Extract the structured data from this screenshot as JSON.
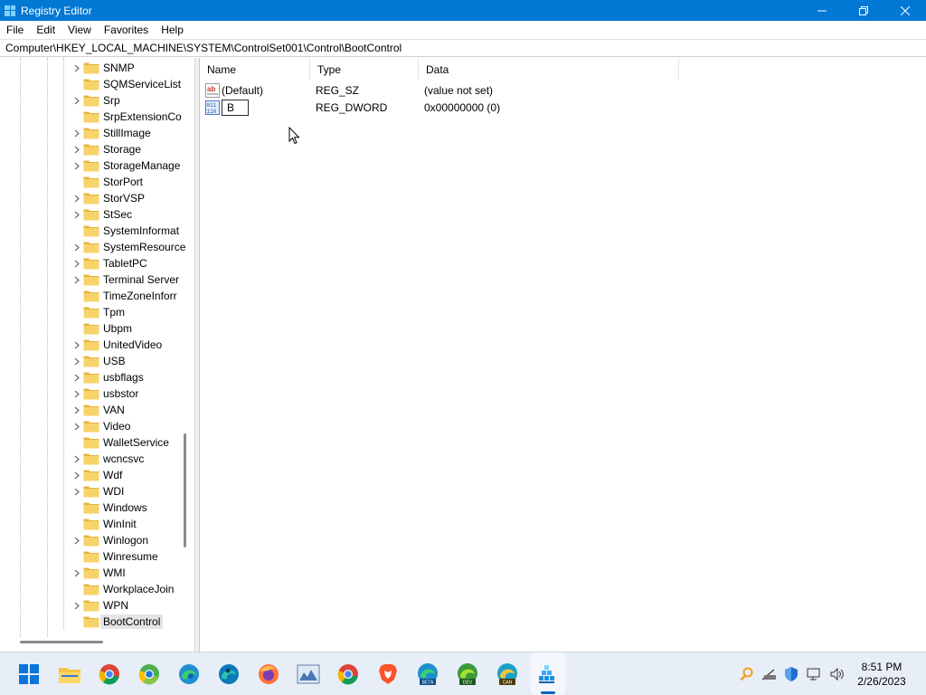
{
  "window": {
    "title": "Registry Editor"
  },
  "menu": [
    "File",
    "Edit",
    "View",
    "Favorites",
    "Help"
  ],
  "address": "Computer\\HKEY_LOCAL_MACHINE\\SYSTEM\\ControlSet001\\Control\\BootControl",
  "tree": {
    "items": [
      {
        "label": "SNMP",
        "expandable": true
      },
      {
        "label": "SQMServiceList",
        "expandable": false
      },
      {
        "label": "Srp",
        "expandable": true
      },
      {
        "label": "SrpExtensionCo",
        "expandable": false
      },
      {
        "label": "StillImage",
        "expandable": true
      },
      {
        "label": "Storage",
        "expandable": true
      },
      {
        "label": "StorageManage",
        "expandable": true
      },
      {
        "label": "StorPort",
        "expandable": false
      },
      {
        "label": "StorVSP",
        "expandable": true
      },
      {
        "label": "StSec",
        "expandable": true
      },
      {
        "label": "SystemInformat",
        "expandable": false
      },
      {
        "label": "SystemResource",
        "expandable": true
      },
      {
        "label": "TabletPC",
        "expandable": true
      },
      {
        "label": "Terminal Server",
        "expandable": true
      },
      {
        "label": "TimeZoneInforr",
        "expandable": false
      },
      {
        "label": "Tpm",
        "expandable": false
      },
      {
        "label": "Ubpm",
        "expandable": false
      },
      {
        "label": "UnitedVideo",
        "expandable": true
      },
      {
        "label": "USB",
        "expandable": true
      },
      {
        "label": "usbflags",
        "expandable": true
      },
      {
        "label": "usbstor",
        "expandable": true
      },
      {
        "label": "VAN",
        "expandable": true
      },
      {
        "label": "Video",
        "expandable": true
      },
      {
        "label": "WalletService",
        "expandable": false
      },
      {
        "label": "wcncsvc",
        "expandable": true
      },
      {
        "label": "Wdf",
        "expandable": true
      },
      {
        "label": "WDI",
        "expandable": true
      },
      {
        "label": "Windows",
        "expandable": false
      },
      {
        "label": "WinInit",
        "expandable": false
      },
      {
        "label": "Winlogon",
        "expandable": true
      },
      {
        "label": "Winresume",
        "expandable": false
      },
      {
        "label": "WMI",
        "expandable": true
      },
      {
        "label": "WorkplaceJoin",
        "expandable": false
      },
      {
        "label": "WPN",
        "expandable": true
      },
      {
        "label": "BootControl",
        "expandable": false,
        "selected": true
      }
    ]
  },
  "values": {
    "columns": {
      "name": "Name",
      "type": "Type",
      "data": "Data"
    },
    "rows": [
      {
        "name": "(Default)",
        "type": "REG_SZ",
        "data": "(value not set)",
        "icon": "string-value-icon"
      },
      {
        "name": "B",
        "type": "REG_DWORD",
        "data": "0x00000000 (0)",
        "icon": "binary-value-icon",
        "editing": true
      }
    ]
  },
  "taskbar": {
    "clock": {
      "time": "8:51 PM",
      "date": "2/26/2023"
    },
    "edge_badges": {
      "beta": "BETA",
      "dev": "DEV",
      "canary": "CAN"
    },
    "app_icons": [
      "start-icon",
      "file-explorer-icon",
      "chrome-icon",
      "chrome-variant-icon",
      "edge-icon",
      "edge-variant-icon",
      "firefox-icon",
      "photos-icon",
      "chrome-icon",
      "brave-icon",
      "edge-beta-icon",
      "edge-dev-icon",
      "edge-canary-icon",
      "registry-editor-icon"
    ],
    "tray_icons": [
      "search-tray-icon",
      "network-icon",
      "security-icon",
      "display-icon",
      "volume-icon"
    ]
  },
  "colors": {
    "titlebar": "#0078d4",
    "folder": "#f0c14b",
    "accent": "#0067c0"
  }
}
